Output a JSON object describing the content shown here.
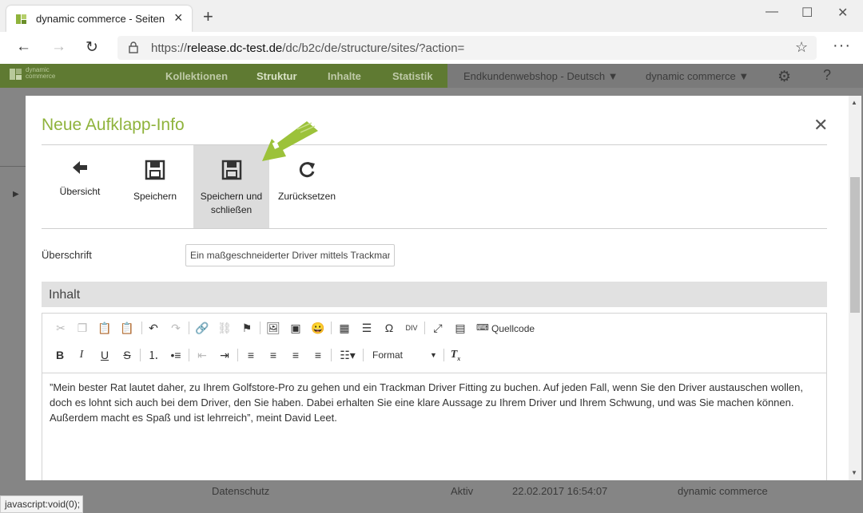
{
  "browser": {
    "tab_title": "dynamic commerce - Seiten",
    "url_prefix": "https://",
    "url_domain": "release.dc-test.de",
    "url_path": "/dc/b2c/de/structure/sites/?action=",
    "status_text": "javascript:void(0);"
  },
  "app": {
    "logo_line1": "dynamic",
    "logo_line2": "commerce",
    "nav": [
      "Kollektionen",
      "Struktur",
      "Inhalte",
      "Statistik"
    ],
    "shop_select": "Endkundenwebshop - Deutsch",
    "company_select": "dynamic commerce",
    "help_label": "?"
  },
  "background_row": {
    "name": "Datenschutz",
    "status": "Aktiv",
    "date": "22.02.2017 16:54:07",
    "owner": "dynamic commerce"
  },
  "modal": {
    "title": "Neue Aufklapp-Info",
    "toolbar": {
      "back": "Übersicht",
      "save": "Speichern",
      "save_close_1": "Speichern und",
      "save_close_2": "schließen",
      "reset": "Zurücksetzen"
    },
    "heading_label": "Überschrift",
    "heading_value": "Ein maßgeschneiderter Driver mittels Trackman",
    "section_title": "Inhalt",
    "editor": {
      "source_label": "Quellcode",
      "format_label": "Format",
      "content": "”Mein bester Rat lautet daher, zu Ihrem Golfstore-Pro zu gehen und ein Trackman Driver Fitting zu buchen. Auf jeden Fall, wenn Sie den Driver austauschen wollen, doch es lohnt sich auch bei dem Driver, den Sie haben. Dabei erhalten Sie eine klare Aussage zu Ihrem Driver und Ihrem Schwung, und was Sie machen können. Außerdem macht es Spaß und ist lehrreich”, meint David Leet."
    }
  },
  "colors": {
    "accent_green": "#8fb33c",
    "app_bar": "#5f7a32",
    "overlay": "#858585"
  }
}
